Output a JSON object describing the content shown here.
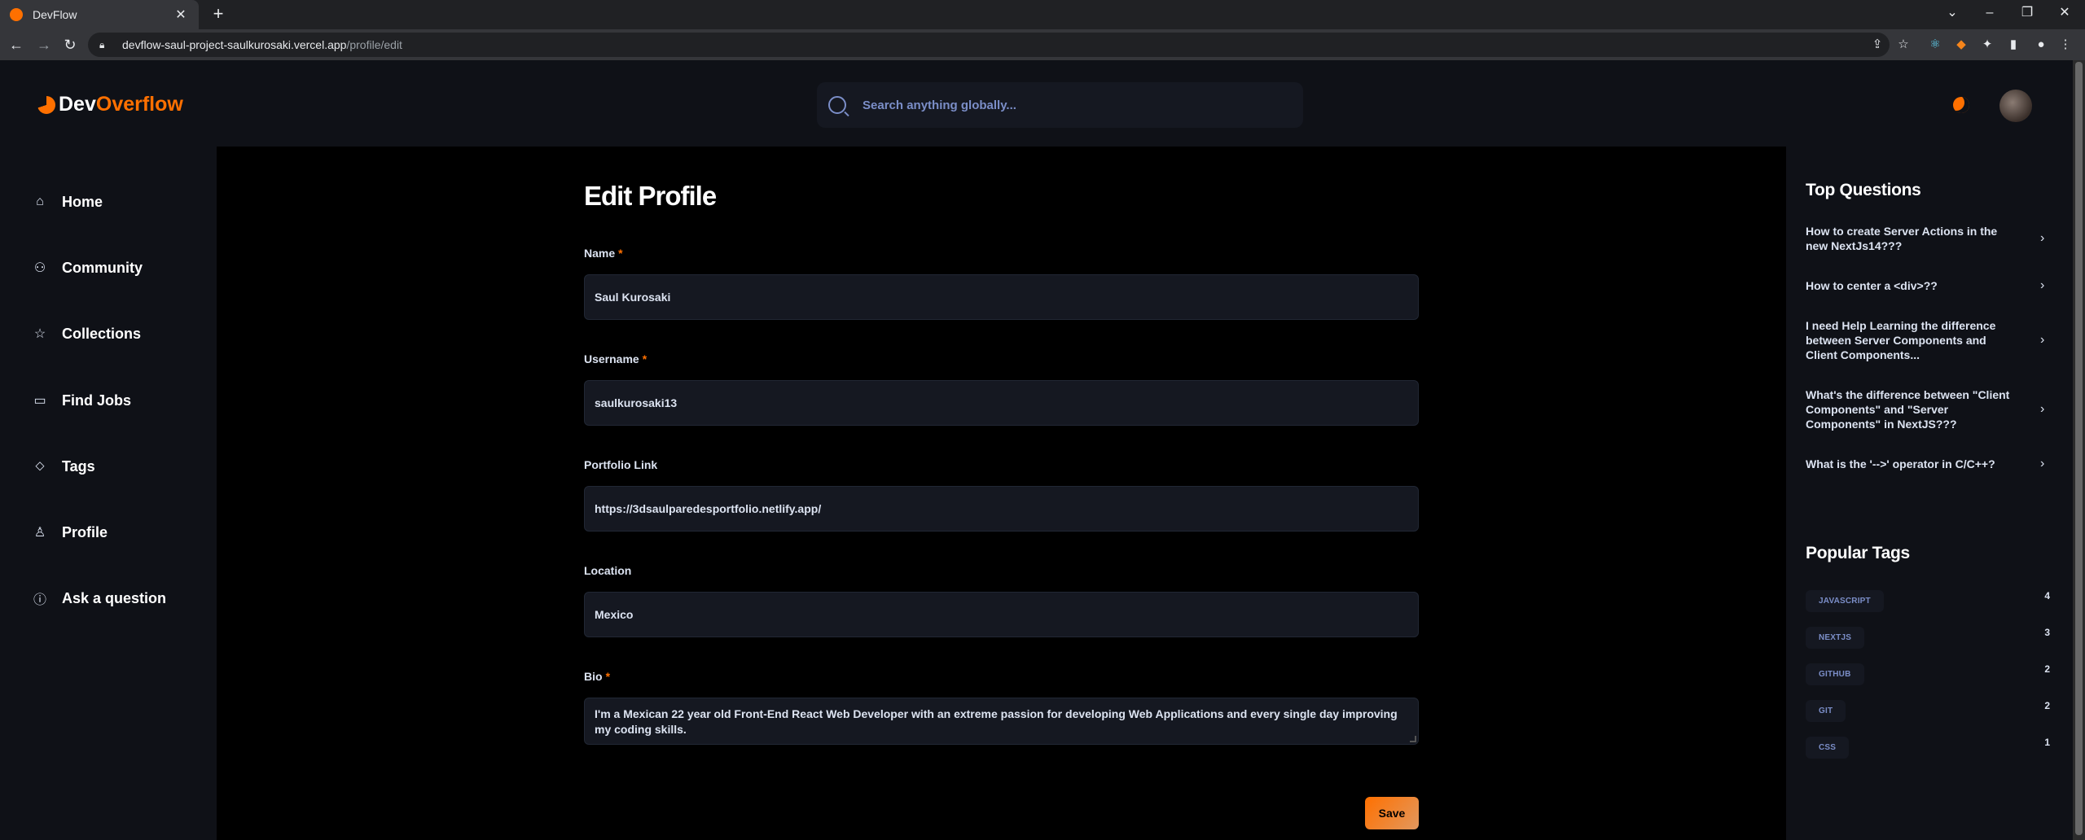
{
  "browser": {
    "tab_title": "DevFlow",
    "url_host": "devflow-saul-project-saulkurosaki.vercel.app",
    "url_path": "/profile/edit"
  },
  "header": {
    "logo_part1": "Dev",
    "logo_part2": "Overflow",
    "search_placeholder": "Search anything globally...",
    "brand_color": "#ff7000"
  },
  "sidebar": {
    "items": [
      {
        "label": "Home",
        "icon": "home-icon"
      },
      {
        "label": "Community",
        "icon": "users-icon"
      },
      {
        "label": "Collections",
        "icon": "star-icon"
      },
      {
        "label": "Find Jobs",
        "icon": "briefcase-icon"
      },
      {
        "label": "Tags",
        "icon": "tag-icon"
      },
      {
        "label": "Profile",
        "icon": "user-icon"
      },
      {
        "label": "Ask a question",
        "icon": "question-icon"
      }
    ]
  },
  "form": {
    "title": "Edit Profile",
    "required_mark": "*",
    "name_label": "Name",
    "name_value": "Saul Kurosaki",
    "username_label": "Username",
    "username_value": "saulkurosaki13",
    "portfolio_label": "Portfolio Link",
    "portfolio_value": "https://3dsaulparedesportfolio.netlify.app/",
    "location_label": "Location",
    "location_value": "Mexico",
    "bio_label": "Bio",
    "bio_value": "I'm a Mexican 22 year old Front-End React Web Developer with an extreme passion for developing Web Applications and every single day improving my coding skills.",
    "save_label": "Save"
  },
  "right": {
    "top_questions_title": "Top Questions",
    "questions": [
      "How to create Server Actions in the new NextJs14???",
      "How to center a <div>??",
      "I need Help Learning the difference between Server Components and Client Components...",
      "What's the difference between \"Client Components\" and \"Server Components\" in NextJS???",
      "What is the '-->' operator in C/C++?"
    ],
    "popular_tags_title": "Popular Tags",
    "tags": [
      {
        "name": "JAVASCRIPT",
        "count": "4"
      },
      {
        "name": "NEXTJS",
        "count": "3"
      },
      {
        "name": "GITHUB",
        "count": "2"
      },
      {
        "name": "GIT",
        "count": "2"
      },
      {
        "name": "CSS",
        "count": "1"
      }
    ]
  }
}
